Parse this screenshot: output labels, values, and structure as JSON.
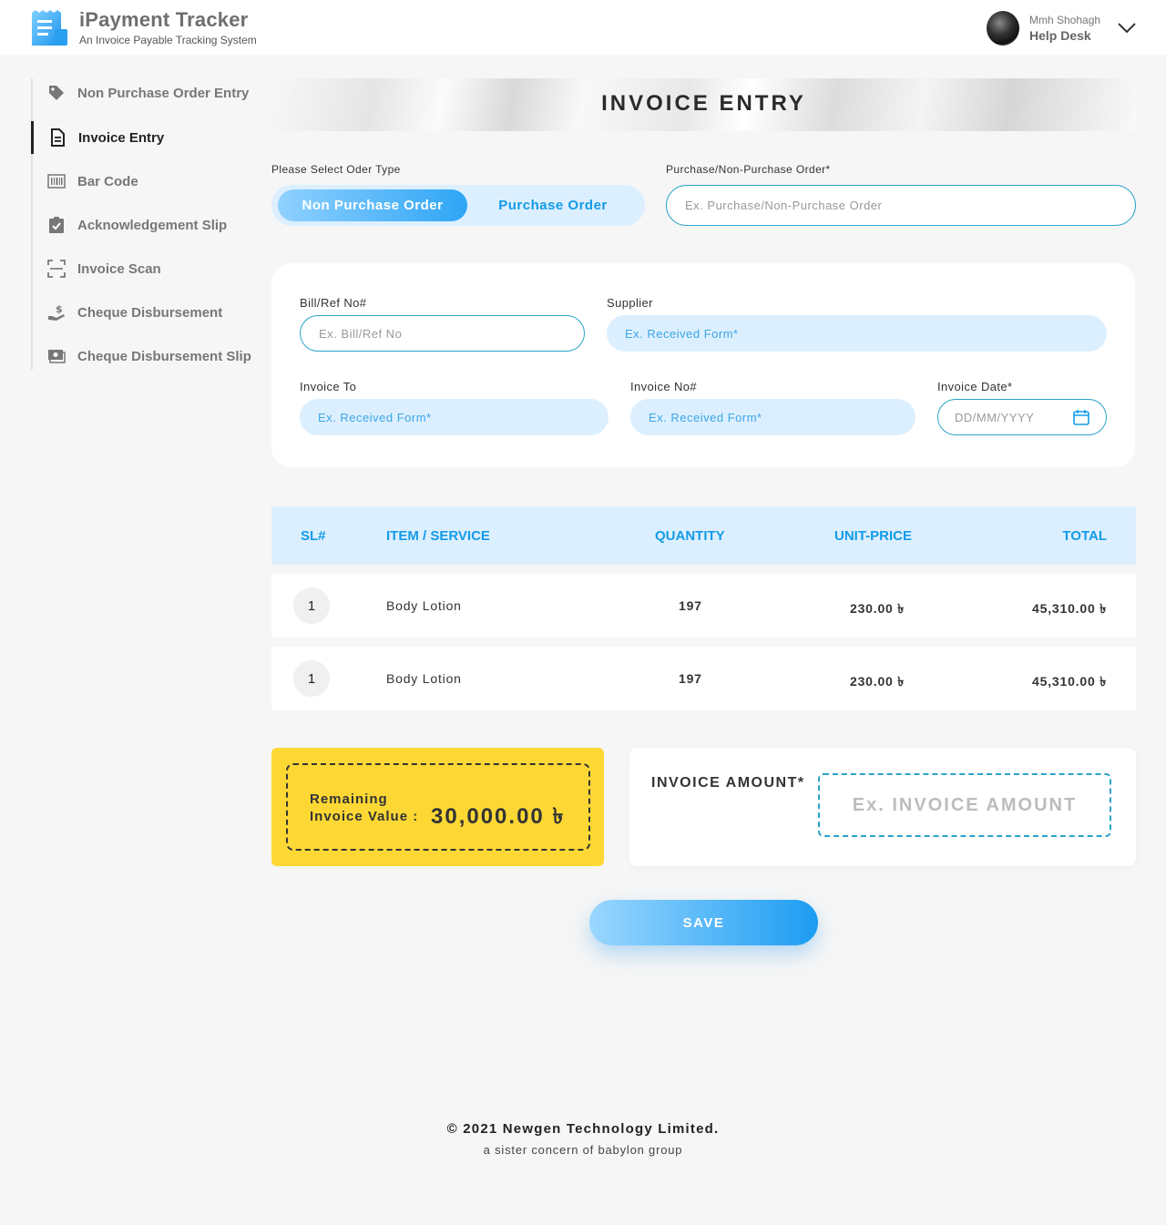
{
  "header": {
    "app_title": "iPayment Tracker",
    "app_subtitle": "An Invoice Payable Tracking System",
    "user_name": "Mmh Shohagh",
    "user_role": "Help Desk"
  },
  "sidebar": {
    "items": [
      {
        "label": "Non Purchase Order Entry",
        "icon": "tag-icon"
      },
      {
        "label": "Invoice Entry",
        "icon": "document-icon",
        "active": true
      },
      {
        "label": "Bar Code",
        "icon": "barcode-icon"
      },
      {
        "label": "Acknowledgement Slip",
        "icon": "clipboard-check-icon"
      },
      {
        "label": "Invoice Scan",
        "icon": "scan-icon"
      },
      {
        "label": "Cheque Disbursement",
        "icon": "hand-money-icon"
      },
      {
        "label": "Cheque Disbursement Slip",
        "icon": "cash-slip-icon"
      }
    ]
  },
  "banner": {
    "title": "INVOICE ENTRY"
  },
  "order_type": {
    "label": "Please Select Oder Type",
    "options": [
      "Non Purchase Order",
      "Purchase Order"
    ],
    "selected": "Non Purchase Order"
  },
  "po": {
    "label": "Purchase/Non-Purchase Order*",
    "placeholder": "Ex. Purchase/Non-Purchase Order"
  },
  "form": {
    "bill_label": "Bill/Ref No#",
    "bill_placeholder": "Ex. Bill/Ref No",
    "supplier_label": "Supplier",
    "supplier_placeholder": "Ex. Received Form*",
    "invoice_to_label": "Invoice To",
    "invoice_to_placeholder": "Ex. Received Form*",
    "invoice_no_label": "Invoice No#",
    "invoice_no_placeholder": "Ex. Received Form*",
    "invoice_date_label": "Invoice Date*",
    "invoice_date_placeholder": "DD/MM/YYYY"
  },
  "table": {
    "headers": [
      "SL#",
      "ITEM / SERVICE",
      "QUANTITY",
      "UNIT-PRICE",
      "TOTAL"
    ],
    "rows": [
      [
        "1",
        "Body Lotion",
        "197",
        "230.00 ৳",
        "45,310.00 ৳"
      ],
      [
        "1",
        "Body Lotion",
        "197",
        "230.00 ৳",
        "45,310.00 ৳"
      ]
    ]
  },
  "remaining": {
    "label_line1": "Remaining",
    "label_line2": "Invoice Value :",
    "value": "30,000.00 ৳"
  },
  "invoice_amount": {
    "label": "INVOICE AMOUNT*",
    "placeholder": "Ex. INVOICE AMOUNT"
  },
  "save_label": "SAVE",
  "footer": {
    "line1": "© 2021 Newgen Technology Limited.",
    "line2": "a sister concern of babylon group"
  },
  "colors": {
    "accent": "#139be8",
    "light_blue": "#dcefff",
    "yellow": "#fdd835"
  }
}
